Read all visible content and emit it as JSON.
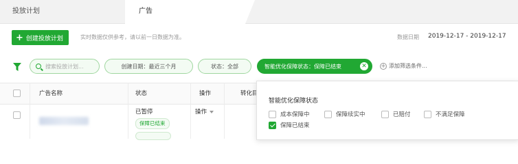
{
  "tabs": [
    {
      "label": "投放计划"
    },
    {
      "label": "广告"
    }
  ],
  "toolbar": {
    "create_label": "创建投放计划",
    "hint": "实时数据仅供参考，请以前一日数据为准。",
    "date_label": "数据日期",
    "date_range": "2019-12-17 - 2019-12-17"
  },
  "filters": {
    "search_placeholder": "搜索投放计划...",
    "date_pill": "创建日期：最近三个月",
    "status_pill": "状态：全部",
    "active_pill": "智能优化保障状态：保障已结束",
    "add_filter": "添加筛选条件..."
  },
  "table": {
    "headers": [
      "广告名称",
      "状态",
      "操作",
      "转化目"
    ],
    "rows": [
      {
        "status": "已暂停",
        "tag": "保障已结束",
        "op": "操作"
      }
    ]
  },
  "dropdown": {
    "title": "智能优化保障状态",
    "options": [
      {
        "label": "成本保障中",
        "checked": false
      },
      {
        "label": "保障续实中",
        "checked": false
      },
      {
        "label": "已赔付",
        "checked": false
      },
      {
        "label": "不满足保障",
        "checked": false
      },
      {
        "label": "保障已结束",
        "checked": true
      }
    ]
  },
  "colors": {
    "accent": "#21a833"
  }
}
